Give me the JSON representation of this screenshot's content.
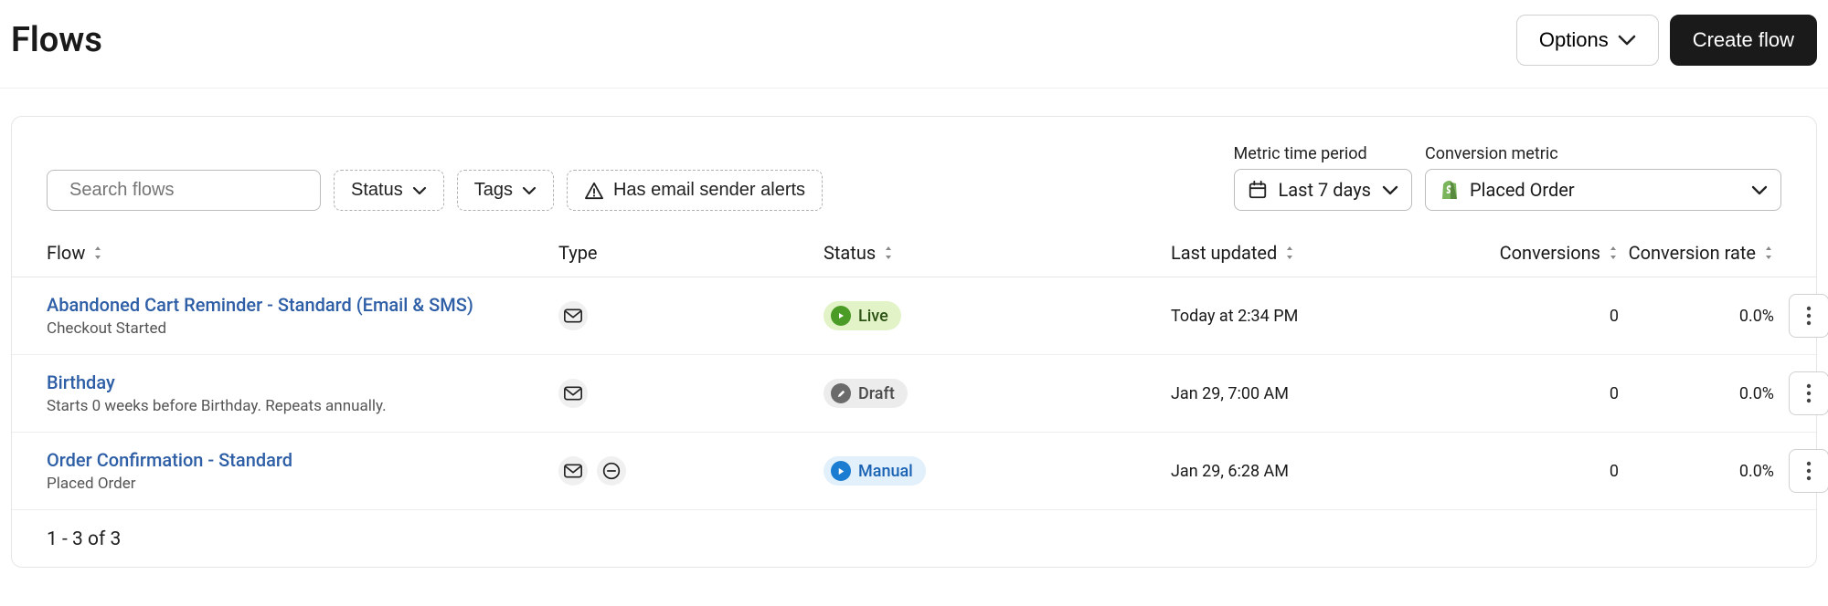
{
  "header": {
    "title": "Flows",
    "options_label": "Options",
    "create_label": "Create flow"
  },
  "toolbar": {
    "search_placeholder": "Search flows",
    "status_label": "Status",
    "tags_label": "Tags",
    "alert_label": "Has email sender alerts",
    "metric_period_label": "Metric time period",
    "metric_period_value": "Last 7 days",
    "conversion_metric_label": "Conversion metric",
    "conversion_metric_value": "Placed Order"
  },
  "columns": {
    "flow": "Flow",
    "type": "Type",
    "status": "Status",
    "last_updated": "Last updated",
    "conversions": "Conversions",
    "conversion_rate": "Conversion rate"
  },
  "rows": [
    {
      "name": "Abandoned Cart Reminder - Standard (Email & SMS)",
      "subtitle": "Checkout Started",
      "types": [
        "email"
      ],
      "status": "Live",
      "status_kind": "live",
      "last_updated": "Today at 2:34 PM",
      "conversions": "0",
      "conversion_rate": "0.0%"
    },
    {
      "name": "Birthday",
      "subtitle": "Starts 0 weeks before Birthday. Repeats annually.",
      "types": [
        "email"
      ],
      "status": "Draft",
      "status_kind": "draft",
      "last_updated": "Jan 29, 7:00 AM",
      "conversions": "0",
      "conversion_rate": "0.0%"
    },
    {
      "name": "Order Confirmation - Standard",
      "subtitle": "Placed Order",
      "types": [
        "email",
        "sms"
      ],
      "status": "Manual",
      "status_kind": "manual",
      "last_updated": "Jan 29, 6:28 AM",
      "conversions": "0",
      "conversion_rate": "0.0%"
    }
  ],
  "pagination": "1 - 3 of 3"
}
